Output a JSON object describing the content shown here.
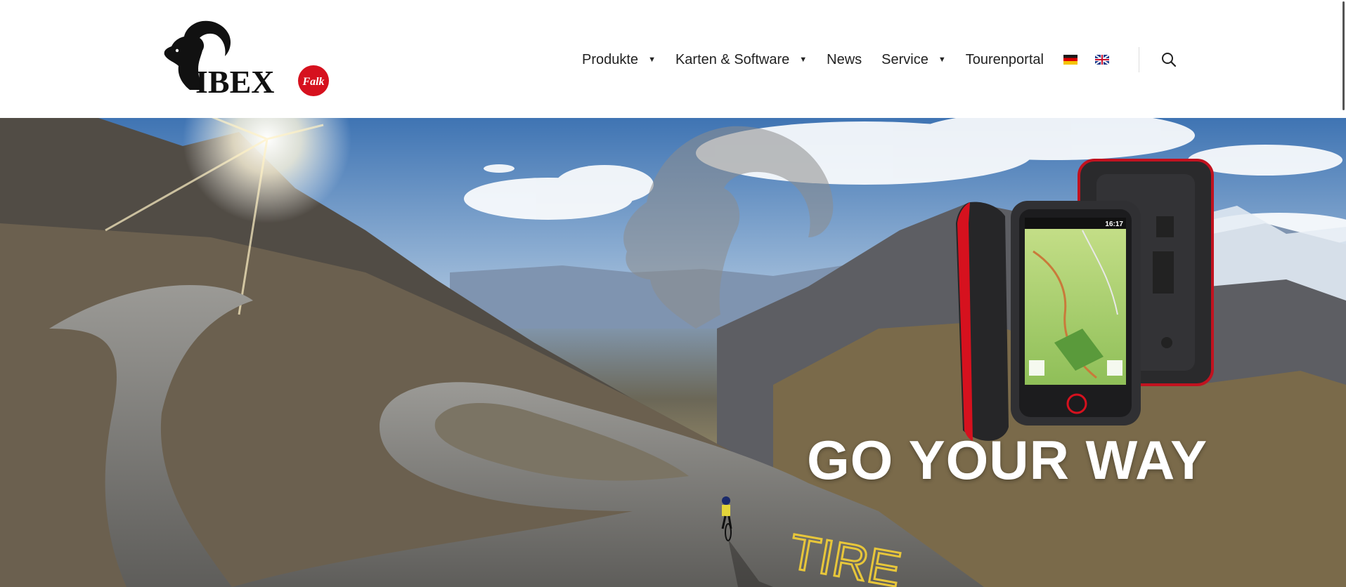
{
  "brand": {
    "logo_text": "IBEX",
    "logo_badge": "Falk",
    "logo_icon": "ibex-head-icon"
  },
  "nav": {
    "items": [
      {
        "label": "Produkte",
        "has_dropdown": true
      },
      {
        "label": "Karten & Software",
        "has_dropdown": true
      },
      {
        "label": "News",
        "has_dropdown": false
      },
      {
        "label": "Service",
        "has_dropdown": true
      },
      {
        "label": "Tourenportal",
        "has_dropdown": false
      }
    ],
    "flags": [
      "flag-de-icon",
      "flag-en-icon"
    ],
    "search_icon": "search-icon"
  },
  "hero": {
    "title": "GO YOUR WAY",
    "device_time": "16:17",
    "road_text": "TIRE"
  },
  "colors": {
    "brand_red": "#d6111e",
    "text_dark": "#222222",
    "hero_text": "#ffffff"
  }
}
